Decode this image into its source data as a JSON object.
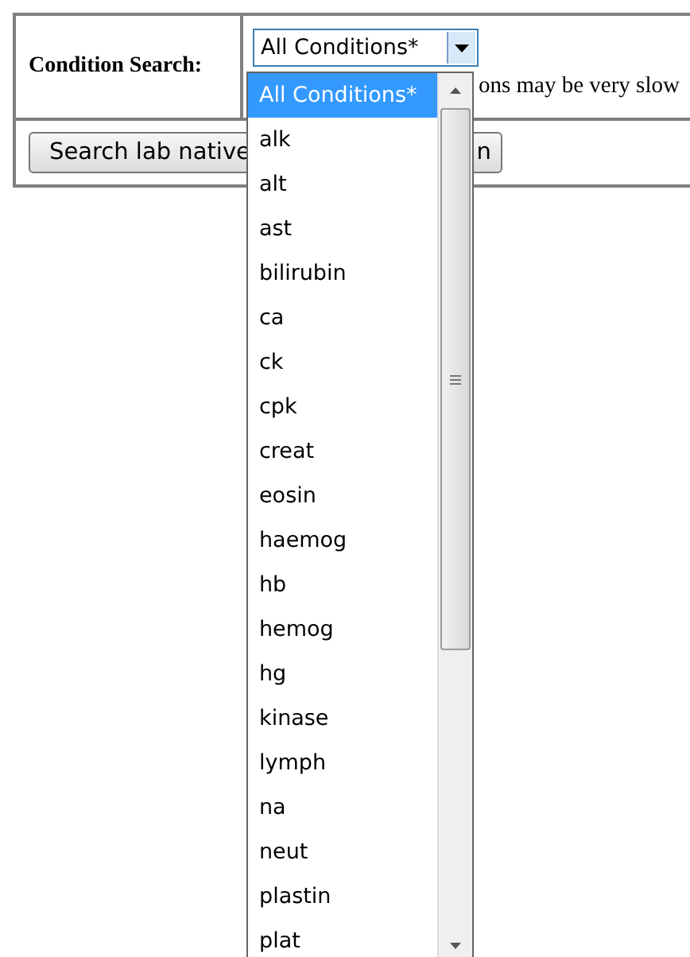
{
  "form": {
    "label": "Condition Search:",
    "select": {
      "value": "All Conditions*",
      "expanded": true
    },
    "hint": "ons may be very slow",
    "button": {
      "text_left": "Search lab native",
      "text_right": "n"
    }
  },
  "dropdown": {
    "options": [
      {
        "label": "All Conditions*",
        "selected": true
      },
      {
        "label": "alk",
        "selected": false
      },
      {
        "label": "alt",
        "selected": false
      },
      {
        "label": "ast",
        "selected": false
      },
      {
        "label": "bilirubin",
        "selected": false
      },
      {
        "label": "ca",
        "selected": false
      },
      {
        "label": "ck",
        "selected": false
      },
      {
        "label": "cpk",
        "selected": false
      },
      {
        "label": "creat",
        "selected": false
      },
      {
        "label": "eosin",
        "selected": false
      },
      {
        "label": "haemog",
        "selected": false
      },
      {
        "label": "hb",
        "selected": false
      },
      {
        "label": "hemog",
        "selected": false
      },
      {
        "label": "hg",
        "selected": false
      },
      {
        "label": "kinase",
        "selected": false
      },
      {
        "label": "lymph",
        "selected": false
      },
      {
        "label": "na",
        "selected": false
      },
      {
        "label": "neut",
        "selected": false
      },
      {
        "label": "plastin",
        "selected": false
      },
      {
        "label": "plat",
        "selected": false
      }
    ]
  }
}
